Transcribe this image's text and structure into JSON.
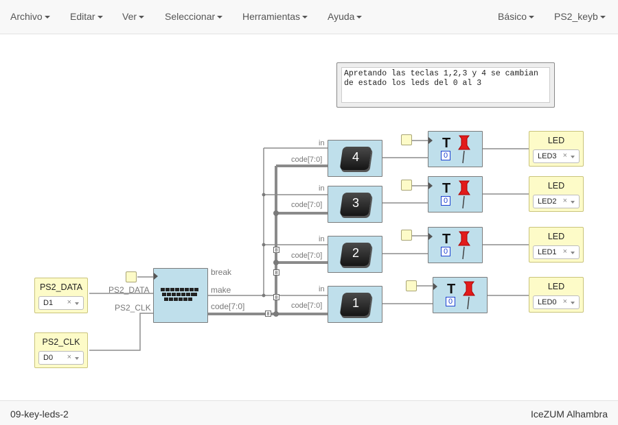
{
  "menu": {
    "left": [
      "Archivo",
      "Editar",
      "Ver",
      "Seleccionar",
      "Herramientas",
      "Ayuda"
    ],
    "right": [
      "Básico",
      "PS2_keyb"
    ]
  },
  "comment": "Apretando las teclas 1,2,3 y 4 se cambian de estado los leds del 0 al 3",
  "inputs": [
    {
      "label": "PS2_DATA",
      "pin": "D1"
    },
    {
      "label": "PS2_CLK",
      "pin": "D0"
    }
  ],
  "ps2_block": {
    "in_ports": [
      "PS2_DATA",
      "PS2_CLK"
    ],
    "out_ports": [
      "break",
      "make",
      "code[7:0]"
    ]
  },
  "key_blocks": [
    {
      "key": "4",
      "in": "in",
      "code": "code[7:0]"
    },
    {
      "key": "3",
      "in": "in",
      "code": "code[7:0]"
    },
    {
      "key": "2",
      "in": "in",
      "code": "code[7:0]"
    },
    {
      "key": "1",
      "in": "in",
      "code": "code[7:0]"
    }
  ],
  "toggle": {
    "glyph": "T",
    "value": "0"
  },
  "bus_marker": "8",
  "leds": [
    {
      "title": "LED",
      "pin": "LED3"
    },
    {
      "title": "LED",
      "pin": "LED2"
    },
    {
      "title": "LED",
      "pin": "LED1"
    },
    {
      "title": "LED",
      "pin": "LED0"
    }
  ],
  "footer": {
    "left": "09-key-leds-2",
    "right": "IceZUM Alhambra"
  },
  "icons": [
    "keyboard-icon",
    "pushpin-icon",
    "clock-trigger-icon",
    "chevron-down-icon",
    "clear-x-icon"
  ]
}
